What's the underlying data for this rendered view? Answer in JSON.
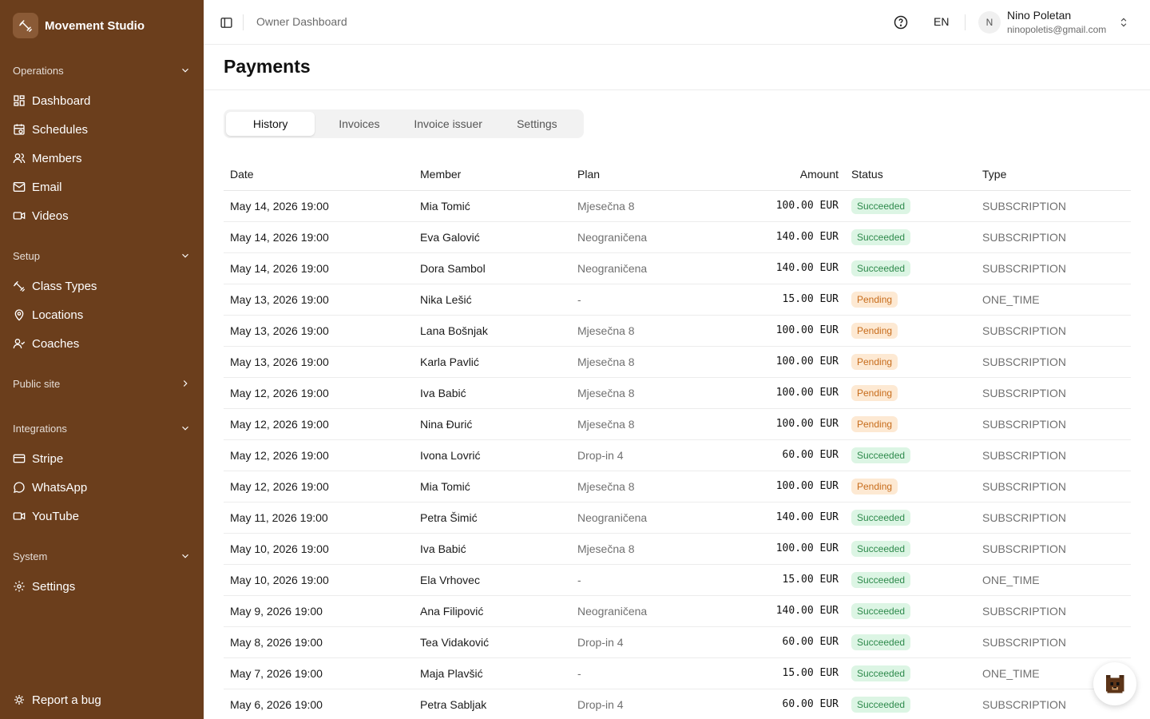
{
  "brand": {
    "name": "Movement Studio"
  },
  "sidebar": {
    "sections": [
      {
        "title": "Operations",
        "items": [
          "Dashboard",
          "Schedules",
          "Members",
          "Email",
          "Videos"
        ]
      },
      {
        "title": "Setup",
        "items": [
          "Class Types",
          "Locations",
          "Coaches"
        ]
      },
      {
        "title": "Public site",
        "items": []
      },
      {
        "title": "Integrations",
        "items": [
          "Stripe",
          "WhatsApp",
          "YouTube"
        ]
      },
      {
        "title": "System",
        "items": [
          "Settings"
        ]
      }
    ],
    "report": "Report a bug"
  },
  "topbar": {
    "breadcrumb": "Owner Dashboard",
    "language": "EN",
    "user": {
      "initial": "N",
      "name": "Nino Poletan",
      "email": "ninopoletis@gmail.com"
    }
  },
  "page": {
    "title": "Payments"
  },
  "tabs": [
    "History",
    "Invoices",
    "Invoice issuer",
    "Settings"
  ],
  "table": {
    "headers": {
      "date": "Date",
      "member": "Member",
      "plan": "Plan",
      "amount": "Amount",
      "status": "Status",
      "type": "Type"
    },
    "rows": [
      {
        "date": "May 14, 2026 19:00",
        "member": "Mia Tomić",
        "plan": "Mjesečna 8",
        "amount": "100.00 EUR",
        "status": "Succeeded",
        "type": "SUBSCRIPTION"
      },
      {
        "date": "May 14, 2026 19:00",
        "member": "Eva Galović",
        "plan": "Neograničena",
        "amount": "140.00 EUR",
        "status": "Succeeded",
        "type": "SUBSCRIPTION"
      },
      {
        "date": "May 14, 2026 19:00",
        "member": "Dora Sambol",
        "plan": "Neograničena",
        "amount": "140.00 EUR",
        "status": "Succeeded",
        "type": "SUBSCRIPTION"
      },
      {
        "date": "May 13, 2026 19:00",
        "member": "Nika Lešić",
        "plan": "-",
        "amount": "15.00 EUR",
        "status": "Pending",
        "type": "ONE_TIME"
      },
      {
        "date": "May 13, 2026 19:00",
        "member": "Lana Bošnjak",
        "plan": "Mjesečna 8",
        "amount": "100.00 EUR",
        "status": "Pending",
        "type": "SUBSCRIPTION"
      },
      {
        "date": "May 13, 2026 19:00",
        "member": "Karla Pavlić",
        "plan": "Mjesečna 8",
        "amount": "100.00 EUR",
        "status": "Pending",
        "type": "SUBSCRIPTION"
      },
      {
        "date": "May 12, 2026 19:00",
        "member": "Iva Babić",
        "plan": "Mjesečna 8",
        "amount": "100.00 EUR",
        "status": "Pending",
        "type": "SUBSCRIPTION"
      },
      {
        "date": "May 12, 2026 19:00",
        "member": "Nina Đurić",
        "plan": "Mjesečna 8",
        "amount": "100.00 EUR",
        "status": "Pending",
        "type": "SUBSCRIPTION"
      },
      {
        "date": "May 12, 2026 19:00",
        "member": "Ivona Lovrić",
        "plan": "Drop-in 4",
        "amount": "60.00 EUR",
        "status": "Succeeded",
        "type": "SUBSCRIPTION"
      },
      {
        "date": "May 12, 2026 19:00",
        "member": "Mia Tomić",
        "plan": "Mjesečna 8",
        "amount": "100.00 EUR",
        "status": "Pending",
        "type": "SUBSCRIPTION"
      },
      {
        "date": "May 11, 2026 19:00",
        "member": "Petra Šimić",
        "plan": "Neograničena",
        "amount": "140.00 EUR",
        "status": "Succeeded",
        "type": "SUBSCRIPTION"
      },
      {
        "date": "May 10, 2026 19:00",
        "member": "Iva Babić",
        "plan": "Mjesečna 8",
        "amount": "100.00 EUR",
        "status": "Succeeded",
        "type": "SUBSCRIPTION"
      },
      {
        "date": "May 10, 2026 19:00",
        "member": "Ela Vrhovec",
        "plan": "-",
        "amount": "15.00 EUR",
        "status": "Succeeded",
        "type": "ONE_TIME"
      },
      {
        "date": "May 9, 2026 19:00",
        "member": "Ana Filipović",
        "plan": "Neograničena",
        "amount": "140.00 EUR",
        "status": "Succeeded",
        "type": "SUBSCRIPTION"
      },
      {
        "date": "May 8, 2026 19:00",
        "member": "Tea Vidaković",
        "plan": "Drop-in 4",
        "amount": "60.00 EUR",
        "status": "Succeeded",
        "type": "SUBSCRIPTION"
      },
      {
        "date": "May 7, 2026 19:00",
        "member": "Maja Plavšić",
        "plan": "-",
        "amount": "15.00 EUR",
        "status": "Succeeded",
        "type": "ONE_TIME"
      },
      {
        "date": "May 6, 2026 19:00",
        "member": "Petra Sabljak",
        "plan": "Drop-in 4",
        "amount": "60.00 EUR",
        "status": "Succeeded",
        "type": "SUBSCRIPTION"
      }
    ]
  },
  "colors": {
    "sidebar_bg": "#6b3e1c",
    "succeeded_bg": "#dcf5e4",
    "succeeded_text": "#2e8a4c",
    "pending_bg": "#fde9d3",
    "pending_text": "#c76c1b"
  }
}
